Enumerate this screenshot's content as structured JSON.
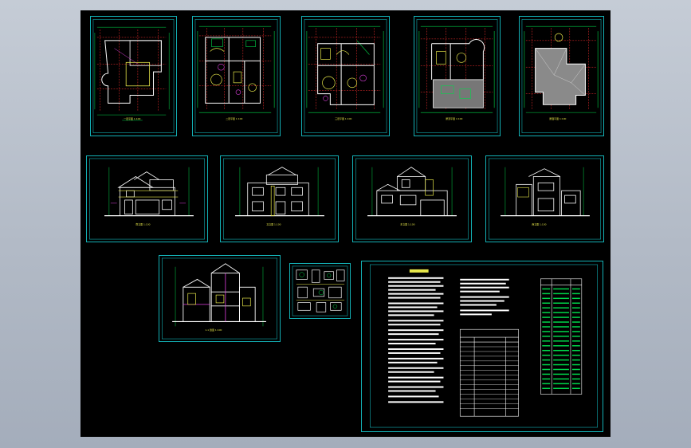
{
  "window": {
    "title": ""
  },
  "drawing": {
    "sheets": [
      {
        "id": "plan-1"
      },
      {
        "id": "plan-2"
      },
      {
        "id": "plan-3"
      },
      {
        "id": "plan-4"
      },
      {
        "id": "plan-5"
      },
      {
        "id": "elev-1"
      },
      {
        "id": "elev-2"
      },
      {
        "id": "elev-3"
      },
      {
        "id": "elev-4"
      },
      {
        "id": "section-1"
      },
      {
        "id": "details-1"
      },
      {
        "id": "notes-1"
      }
    ]
  },
  "colors": {
    "background": "#000000",
    "frame": "#13b0b5",
    "wall": "#ffffff",
    "grid": "#ff3030",
    "dimension": "#00d84a",
    "yellow": "#e8e84a",
    "magenta": "#e040e0"
  }
}
